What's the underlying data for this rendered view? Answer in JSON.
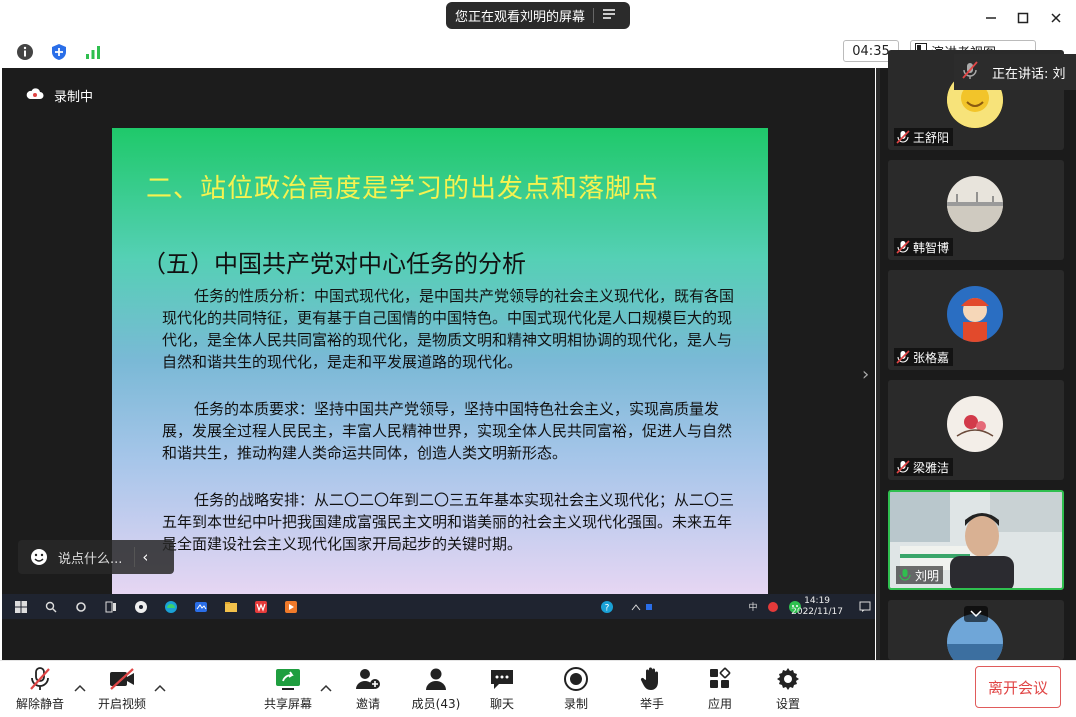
{
  "titlebar": {
    "banner_text": "您正在观看刘明的屏幕"
  },
  "toolbar2": {
    "timer": "04:35",
    "presenter_view": "演讲者视图",
    "speaking": "正在讲话: 刘"
  },
  "content": {
    "recording": "录制中",
    "chat_placeholder": "说点什么..."
  },
  "slide": {
    "title": "二、站位政治高度是学习的出发点和落脚点",
    "subtitle": "（五）中国共产党对中心任务的分析",
    "paragraphs": [
      "任务的性质分析：中国式现代化，是中国共产党领导的社会主义现代化，既有各国现代化的共同特征，更有基于自己国情的中国特色。中国式现代化是人口规模巨大的现代化，是全体人民共同富裕的现代化，是物质文明和精神文明相协调的现代化，是人与自然和谐共生的现代化，是走和平发展道路的现代化。",
      "任务的本质要求：坚持中国共产党领导，坚持中国特色社会主义，实现高质量发展，发展全过程人民民主，丰富人民精神世界，实现全体人民共同富裕，促进人与自然和谐共生，推动构建人类命运共同体，创造人类文明新形态。",
      "任务的战略安排：从二〇二〇年到二〇三五年基本实现社会主义现代化；从二〇三五年到本世纪中叶把我国建成富强民主文明和谐美丽的社会主义现代化强国。未来五年是全面建设社会主义现代化国家开局起步的关键时期。"
    ]
  },
  "taskbar": {
    "time": "14:19",
    "date": "2022/11/17",
    "ime": "中"
  },
  "participants": [
    {
      "name": "王舒阳"
    },
    {
      "name": "韩智博"
    },
    {
      "name": "张格嘉"
    },
    {
      "name": "梁雅洁"
    },
    {
      "name": "刘明"
    }
  ],
  "bottombar": {
    "mute": "解除静音",
    "video": "开启视频",
    "share": "共享屏幕",
    "invite": "邀请",
    "members": "成员(43)",
    "chat": "聊天",
    "record": "录制",
    "raise_hand": "举手",
    "apps": "应用",
    "settings": "设置",
    "leave": "离开会议"
  },
  "colors": {
    "leave_red": "#e04545",
    "active_green": "#2fbf4f",
    "slide_title_yellow": "#f6f250"
  }
}
